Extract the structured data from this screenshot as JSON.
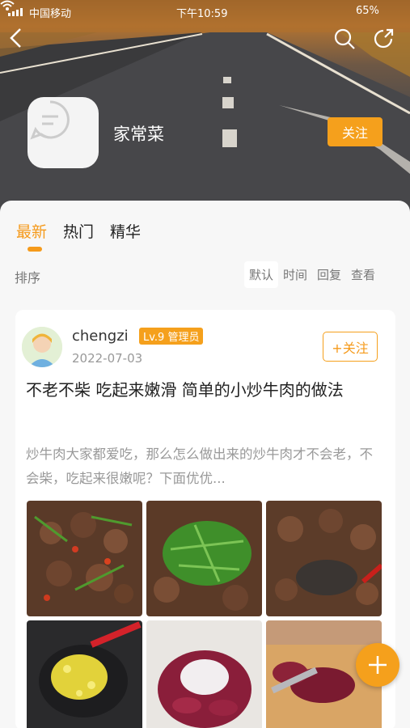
{
  "status_bar": {
    "carrier": "中国移动",
    "time": "下午10:59",
    "battery": "65%"
  },
  "header": {
    "group_name": "家常菜",
    "follow_label": "关注"
  },
  "tabs": [
    {
      "label": "最新",
      "active": true
    },
    {
      "label": "热门",
      "active": false
    },
    {
      "label": "精华",
      "active": false
    }
  ],
  "sort": {
    "label": "排序",
    "options": [
      "默认",
      "时间",
      "回复",
      "查看"
    ],
    "selected": "默认"
  },
  "post": {
    "username": "chengzi",
    "badge": "Lv.9 管理员",
    "date": "2022-07-03",
    "follow_label": "+关注",
    "title": "不老不柴 吃起来嫩滑 简单的小炒牛肉的做法",
    "excerpt": "炒牛肉大家都爱吃，那么怎么做出来的炒牛肉才不会老，不会柴，吃起来很嫩呢？下面优优...",
    "images": [
      "beef-stirfry-with-chili-photo",
      "beef-with-cilantro-photo",
      "beef-in-wok-photo",
      "minced-ginger-pan-photo",
      "raw-beef-slices-with-starch-photo",
      "slicing-raw-beef-photo"
    ]
  },
  "colors": {
    "accent": "#f5a01c",
    "text": "#222222",
    "muted": "#999999"
  }
}
